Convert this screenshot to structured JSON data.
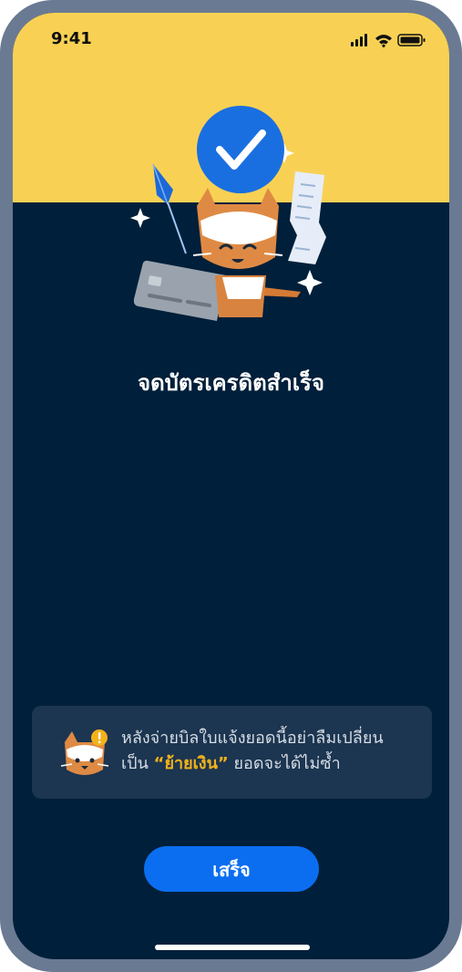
{
  "status_bar": {
    "time": "9:41",
    "icons": [
      "cellular-signal-icon",
      "wifi-icon",
      "battery-icon"
    ]
  },
  "illustration": {
    "icons": [
      "checkmark-badge-icon",
      "cat-mascot-icon",
      "credit-card-icon",
      "receipt-icon",
      "sparkle-icon",
      "kite-icon"
    ],
    "colors": {
      "badge": "#1a6fe0",
      "header_bg": "#f8d154"
    }
  },
  "main": {
    "title": "จดบัตรเครดิตสำเร็จ"
  },
  "notice": {
    "line1": "หลังจ่ายบิลใบแจ้งยอดนี้อย่าลืมเปลี่ยน",
    "line2_prefix": "เป็น",
    "highlight": "“ย้ายเงิน”",
    "line2_suffix": "ยอดจะได้ไม่ซ้ำ",
    "icons": [
      "cat-warning-icon"
    ],
    "colors": {
      "highlight": "#f2b21b",
      "card_bg": "#1c3550"
    }
  },
  "actions": {
    "done_label": "เสร็จ",
    "colors": {
      "button_bg": "#0b6ef0"
    }
  },
  "theme": {
    "background": "#001f3a",
    "frame": "#6a7a93"
  }
}
